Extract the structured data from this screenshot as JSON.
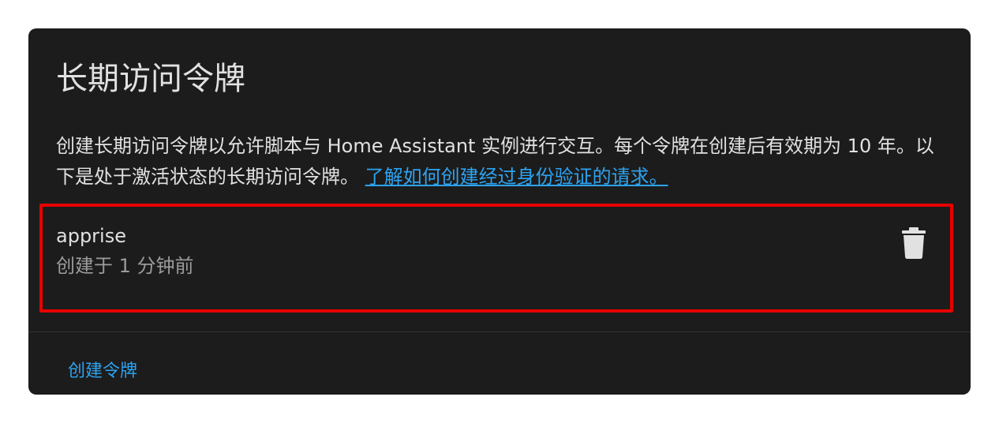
{
  "card": {
    "title": "长期访问令牌",
    "description": "创建长期访问令牌以允许脚本与 Home Assistant 实例进行交互。每个令牌在创建后有效期为 10 年。以下是处于激活状态的长期访问令牌。",
    "learn_more_link": "了解如何创建经过身份验证的请求。"
  },
  "tokens": [
    {
      "name": "apprise",
      "created": "创建于 1 分钟前",
      "delete_icon": "trash-can-icon"
    }
  ],
  "actions": {
    "create_token_label": "创建令牌"
  },
  "colors": {
    "card_background": "#1c1c1c",
    "primary_text": "#e1e1e1",
    "secondary_text": "#9b9b9b",
    "link": "#2da3f0",
    "highlight_border": "#e90000"
  }
}
